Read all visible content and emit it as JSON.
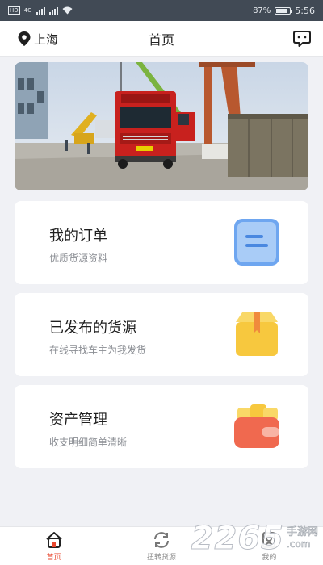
{
  "status_bar": {
    "hd": "HD",
    "network": "4G",
    "battery": "87%",
    "battery_level": 0.87,
    "time": "5:56"
  },
  "header": {
    "city": "上海",
    "title": "首页",
    "icons": {
      "location": "location-pin-icon",
      "message": "message-bubble-icon"
    }
  },
  "banner": {
    "image": "red truck being loaded by crane at cargo yard"
  },
  "cards": [
    {
      "title": "我的订单",
      "subtitle": "优质货源资料",
      "icon": "order-list-icon",
      "color": "#6ea6f0"
    },
    {
      "title": "已发布的货源",
      "subtitle": "在线寻找车主为我发货",
      "icon": "cargo-box-icon",
      "color": "#f7c83e"
    },
    {
      "title": "资产管理",
      "subtitle": "收支明细简单清晰",
      "icon": "wallet-icon",
      "color": "#f0694f"
    }
  ],
  "tabs": [
    {
      "label": "首页",
      "icon": "home-icon",
      "active": true
    },
    {
      "label": "扭转货源",
      "icon": "refresh-icon",
      "active": false
    },
    {
      "label": "我的",
      "icon": "profile-icon",
      "active": false
    }
  ],
  "watermark": {
    "brand": "2265",
    "sub": "手游网",
    "domain": ".com"
  },
  "colors": {
    "accent": "#e8462d",
    "background": "#f0f1f5",
    "status_bar": "#414a55"
  }
}
